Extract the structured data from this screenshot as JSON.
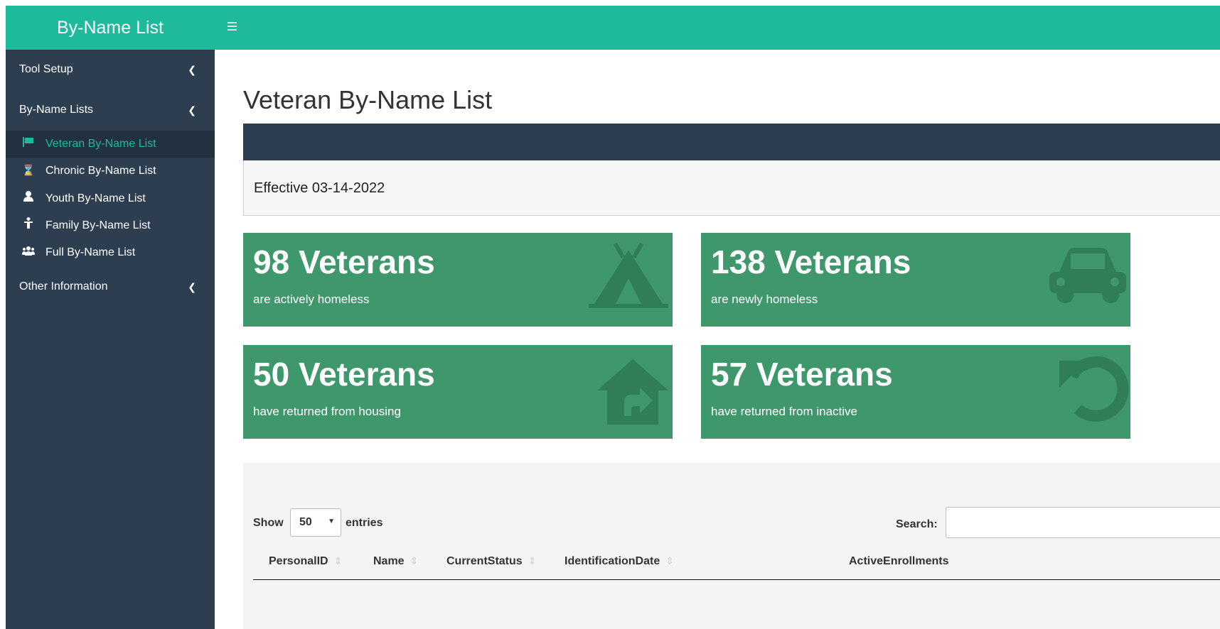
{
  "header": {
    "brand": "By-Name List",
    "menu_icon": "bars-icon"
  },
  "sidebar": {
    "sections": [
      {
        "label": "Tool Setup",
        "icon": "chevron-left-icon"
      },
      {
        "label": "By-Name Lists",
        "icon": "chevron-left-icon"
      },
      {
        "label": "Other Information",
        "icon": "chevron-left-icon"
      }
    ],
    "items": [
      {
        "label": "Veteran By-Name List",
        "icon": "flag-icon",
        "active": true
      },
      {
        "label": "Chronic By-Name List",
        "icon": "hourglass-icon",
        "active": false
      },
      {
        "label": "Youth By-Name List",
        "icon": "user-icon",
        "active": false
      },
      {
        "label": "Family By-Name List",
        "icon": "child-icon",
        "active": false
      },
      {
        "label": "Full By-Name List",
        "icon": "users-icon",
        "active": false
      }
    ]
  },
  "main": {
    "title": "Veteran By-Name List",
    "effective": "Effective 03-14-2022",
    "stats": [
      {
        "value": "98 Veterans",
        "caption": "are actively homeless",
        "icon": "campground-icon"
      },
      {
        "value": "138 Veterans",
        "caption": "are newly homeless",
        "icon": "car-icon"
      },
      {
        "value": "50 Veterans",
        "caption": "have returned from housing",
        "icon": "house-return-icon"
      },
      {
        "value": "57 Veterans",
        "caption": "have returned from inactive",
        "icon": "undo-icon"
      }
    ]
  },
  "table": {
    "show_label": "Show",
    "entries_value": "50",
    "entries_label": "entries",
    "search_label": "Search:",
    "search_value": "",
    "columns": [
      "PersonalID",
      "Name",
      "CurrentStatus",
      "IdentificationDate",
      "ActiveEnrollments"
    ]
  },
  "colors": {
    "header": "#1dba9b",
    "sidebar": "#2c3e50",
    "stat_box": "#3f986b",
    "active_item": "#1dba9b"
  }
}
